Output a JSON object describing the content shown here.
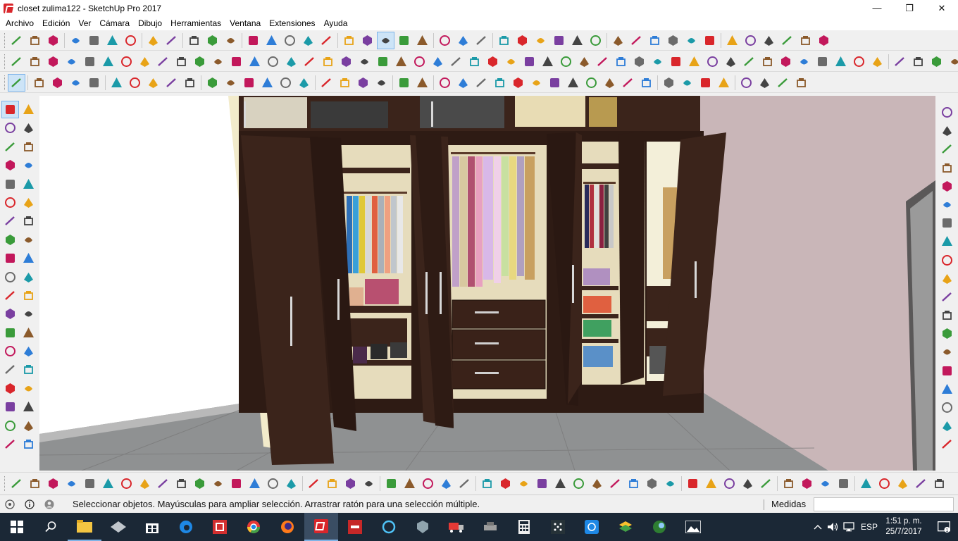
{
  "window": {
    "title": "closet zulima122 - SketchUp Pro 2017",
    "minimize_label": "—",
    "maximize_label": "❐",
    "close_label": "✕"
  },
  "menu": {
    "items": [
      "Archivo",
      "Edición",
      "Ver",
      "Cámara",
      "Dibujo",
      "Herramientas",
      "Ventana",
      "Extensiones",
      "Ayuda"
    ]
  },
  "viewport": {
    "scene": "3D closet model",
    "colors": {
      "wood": "#3b241b",
      "wood_dark": "#2a1812",
      "interior": "#e6dcbc",
      "wall_right": "#c9b6b8",
      "floor": "#8f9192",
      "left_wall": "#ffffff"
    }
  },
  "status": {
    "message": "Seleccionar objetos. Mayúsculas para ampliar selección. Arrastrar ratón para una selección múltiple.",
    "measure_label": "Medidas",
    "measure_value": ""
  },
  "taskbar": {
    "lang": "ESP",
    "time": "1:51 p. m.",
    "date": "25/7/2017",
    "notification_count": "1"
  },
  "icons": {
    "toolbar1": [
      "new-file-icon",
      "open-icon",
      "save-icon",
      "cut-icon",
      "copy-icon",
      "paste-icon",
      "delete-icon",
      "undo-icon",
      "redo-icon",
      "print-icon",
      "model-info-icon",
      "iso-view-icon",
      "top-view-icon",
      "front-view-icon",
      "right-view-icon",
      "back-view-icon",
      "left-view-icon",
      "xray-icon",
      "wireframe-icon",
      "hidden-line-icon",
      "shaded-icon",
      "textured-icon",
      "section-plane-icon",
      "section-display-icon",
      "components-icon",
      "materials-icon",
      "styles-icon",
      "scenes-icon",
      "layers-icon",
      "sandbox-icon",
      "export-icon",
      "import-icon",
      "warehouse-icon",
      "extension-icon",
      "ruby-icon",
      "plugin-icon",
      "fix-icon",
      "tool-a-icon",
      "tool-b-icon",
      "tool-c-icon",
      "tool-d-icon",
      "tool-e-icon",
      "tool-f-icon"
    ],
    "toolbar2_count": 52,
    "toolbar3_count": 42,
    "left_palette_count": 38,
    "right_palette_count": 19,
    "bottom_count": 50
  }
}
